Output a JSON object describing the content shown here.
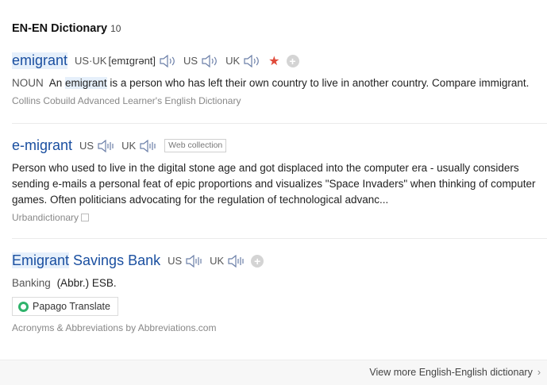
{
  "header": {
    "title": "EN-EN Dictionary",
    "count": "10"
  },
  "entries": [
    {
      "word": "emigrant",
      "pron_label_1": "US·UK",
      "ipa": "[emɪgrənt]",
      "pron_label_2": "US",
      "pron_label_3": "UK",
      "pos": "NOUN",
      "def_before": "An",
      "def_highlight": "emigrant",
      "def_after": "is a person who has left their own country to live in another country. Compare immigrant.",
      "source": "Collins Cobuild Advanced Learner's English Dictionary"
    },
    {
      "word": "e-migrant",
      "pron_label_1": "US",
      "pron_label_2": "UK",
      "tag": "Web collection",
      "definition": "Person who used to live in the digital stone age and got displaced into the computer era - usually considers sending e-mails a personal feat of epic proportions and visualizes \"Space Invaders\" when thinking of computer games. Often politicians advocating for the regulation of technological advanc...",
      "source": "Urbandictionary"
    },
    {
      "word_highlight": "Emigrant",
      "word_rest": " Savings Bank",
      "pron_label_1": "US",
      "pron_label_2": "UK",
      "category": "Banking",
      "definition": "(Abbr.) ESB.",
      "translate_button": "Papago Translate",
      "source": "Acronyms & Abbreviations by Abbreviations.com"
    }
  ],
  "footer": {
    "link": "View more English-English dictionary",
    "chevron": "›"
  },
  "colors": {
    "word": "#1a4fa0",
    "highlight": "#e6f0fb",
    "star": "#e04a3a"
  },
  "icons": [
    "speaker-icon",
    "star-icon",
    "add-icon",
    "copy-icon",
    "papago-icon",
    "chevron-right-icon"
  ]
}
